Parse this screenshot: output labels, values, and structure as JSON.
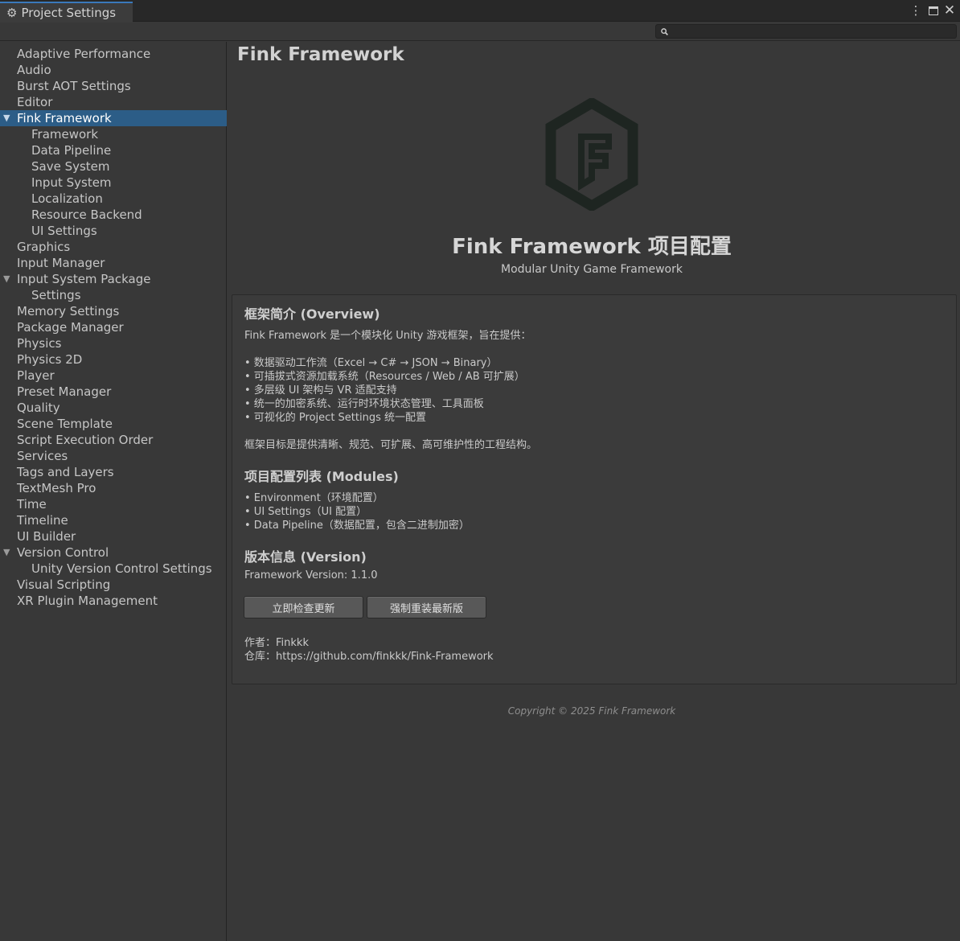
{
  "window": {
    "tab_title": "Project Settings",
    "more_glyph": "⋮",
    "close_glyph": "✕"
  },
  "search": {
    "value": "",
    "placeholder": "",
    "icon": "search-icon"
  },
  "sidebar": {
    "items": [
      {
        "label": "Adaptive Performance",
        "indent": 0,
        "arrow": ""
      },
      {
        "label": "Audio",
        "indent": 0,
        "arrow": ""
      },
      {
        "label": "Burst AOT Settings",
        "indent": 0,
        "arrow": ""
      },
      {
        "label": "Editor",
        "indent": 0,
        "arrow": ""
      },
      {
        "label": "Fink Framework",
        "indent": 0,
        "arrow": "▼",
        "selected": true
      },
      {
        "label": "Framework",
        "indent": 1,
        "arrow": ""
      },
      {
        "label": "Data Pipeline",
        "indent": 1,
        "arrow": ""
      },
      {
        "label": "Save System",
        "indent": 1,
        "arrow": ""
      },
      {
        "label": "Input System",
        "indent": 1,
        "arrow": ""
      },
      {
        "label": "Localization",
        "indent": 1,
        "arrow": ""
      },
      {
        "label": "Resource Backend",
        "indent": 1,
        "arrow": ""
      },
      {
        "label": "UI Settings",
        "indent": 1,
        "arrow": ""
      },
      {
        "label": "Graphics",
        "indent": 0,
        "arrow": ""
      },
      {
        "label": "Input Manager",
        "indent": 0,
        "arrow": ""
      },
      {
        "label": "Input System Package",
        "indent": 0,
        "arrow": "▼"
      },
      {
        "label": "Settings",
        "indent": 1,
        "arrow": ""
      },
      {
        "label": "Memory Settings",
        "indent": 0,
        "arrow": ""
      },
      {
        "label": "Package Manager",
        "indent": 0,
        "arrow": ""
      },
      {
        "label": "Physics",
        "indent": 0,
        "arrow": ""
      },
      {
        "label": "Physics 2D",
        "indent": 0,
        "arrow": ""
      },
      {
        "label": "Player",
        "indent": 0,
        "arrow": ""
      },
      {
        "label": "Preset Manager",
        "indent": 0,
        "arrow": ""
      },
      {
        "label": "Quality",
        "indent": 0,
        "arrow": ""
      },
      {
        "label": "Scene Template",
        "indent": 0,
        "arrow": ""
      },
      {
        "label": "Script Execution Order",
        "indent": 0,
        "arrow": ""
      },
      {
        "label": "Services",
        "indent": 0,
        "arrow": ""
      },
      {
        "label": "Tags and Layers",
        "indent": 0,
        "arrow": ""
      },
      {
        "label": "TextMesh Pro",
        "indent": 0,
        "arrow": ""
      },
      {
        "label": "Time",
        "indent": 0,
        "arrow": ""
      },
      {
        "label": "Timeline",
        "indent": 0,
        "arrow": ""
      },
      {
        "label": "UI Builder",
        "indent": 0,
        "arrow": ""
      },
      {
        "label": "Version Control",
        "indent": 0,
        "arrow": "▼"
      },
      {
        "label": "Unity Version Control Settings",
        "indent": 1,
        "arrow": ""
      },
      {
        "label": "Visual Scripting",
        "indent": 0,
        "arrow": ""
      },
      {
        "label": "XR Plugin Management",
        "indent": 0,
        "arrow": ""
      }
    ]
  },
  "main": {
    "page_title": "Fink Framework",
    "logo_letter": "F",
    "hero_title": "Fink Framework 项目配置",
    "hero_subtitle": "Modular Unity Game Framework",
    "overview": {
      "title": "框架简介 (Overview)",
      "intro": "Fink Framework 是一个模块化 Unity 游戏框架，旨在提供：",
      "bullets": [
        "• 数据驱动工作流（Excel → C# → JSON → Binary）",
        "• 可插拔式资源加载系统（Resources / Web / AB 可扩展）",
        "• 多层级 UI 架构与 VR 适配支持",
        "• 统一的加密系统、运行时环境状态管理、工具面板",
        "• 可视化的 Project Settings 统一配置"
      ],
      "goal": "框架目标是提供清晰、规范、可扩展、高可维护性的工程结构。"
    },
    "modules": {
      "title": "项目配置列表 (Modules)",
      "bullets": [
        "• Environment（环境配置）",
        "• UI Settings（UI 配置）",
        "• Data Pipeline（数据配置，包含二进制加密）"
      ]
    },
    "version": {
      "title": "版本信息 (Version)",
      "text": "Framework Version: 1.1.0",
      "check_button": "立即检查更新",
      "reinstall_button": "强制重装最新版",
      "author": "作者：Finkkk",
      "repo": "仓库：https://github.com/finkkk/Fink-Framework"
    },
    "copyright": "Copyright © 2025 Fink Framework"
  },
  "colors": {
    "accent": "#3a79bb",
    "selection": "#2c5d87",
    "background": "#383838"
  }
}
